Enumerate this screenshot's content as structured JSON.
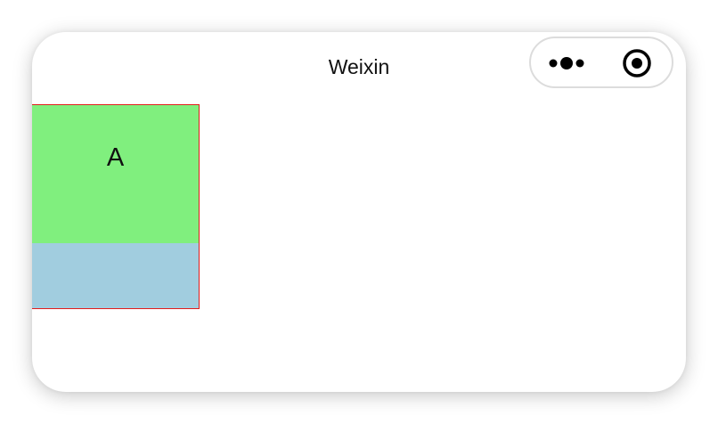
{
  "nav": {
    "title": "Weixin"
  },
  "capsule": {
    "more_icon": "more-dots-icon",
    "close_icon": "target-circle-icon"
  },
  "block": {
    "label": "A",
    "top_color": "#80ef7e",
    "bottom_color": "#a1cddf",
    "border_color": "#e21c1c"
  }
}
